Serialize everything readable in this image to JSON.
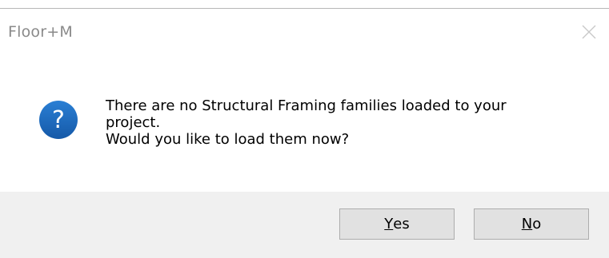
{
  "dialog": {
    "title": "Floor+M",
    "message_lines": [
      "There are no Structural Framing families loaded to your",
      "project.",
      "Would you like to load them now?"
    ],
    "icons": {
      "question": "question-icon",
      "close": "close-icon"
    },
    "buttons": {
      "yes_mnemonic": "Y",
      "yes_rest": "es",
      "no_mnemonic": "N",
      "no_rest": "o"
    }
  }
}
